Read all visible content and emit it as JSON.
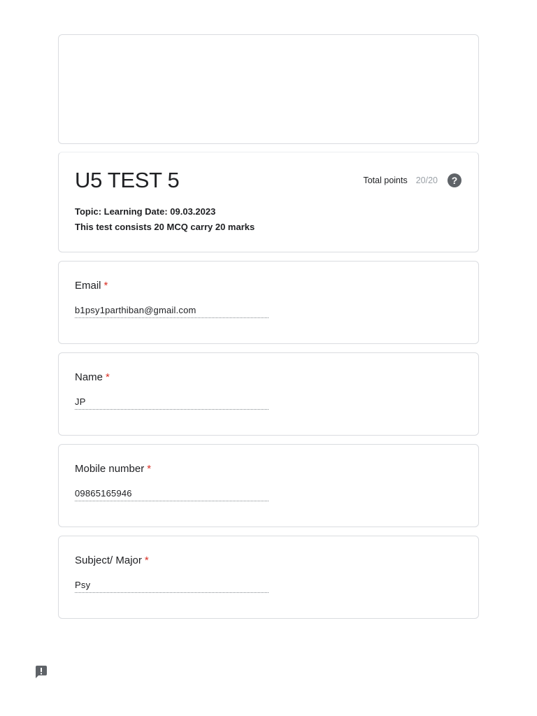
{
  "form": {
    "title": "U5 TEST 5",
    "description_line1": "Topic: Learning Date: 09.03.2023",
    "description_line2": "This test consists 20 MCQ carry 20 marks",
    "points_label": "Total points",
    "points_value": "20/20",
    "help_icon": "?"
  },
  "questions": [
    {
      "label": "Email",
      "required_mark": "*",
      "answer": "b1psy1parthiban@gmail.com"
    },
    {
      "label": "Name",
      "required_mark": "*",
      "answer": "JP"
    },
    {
      "label": "Mobile number",
      "required_mark": "*",
      "answer": "09865165946"
    },
    {
      "label": "Subject/ Major",
      "required_mark": "*",
      "answer": "Psy"
    }
  ],
  "colors": {
    "required": "#d93025",
    "border": "#dadce0",
    "muted": "#9aa0a6",
    "icon": "#5f6368"
  },
  "icons": {
    "help": "help-circle-icon",
    "report": "report-feedback-icon"
  }
}
